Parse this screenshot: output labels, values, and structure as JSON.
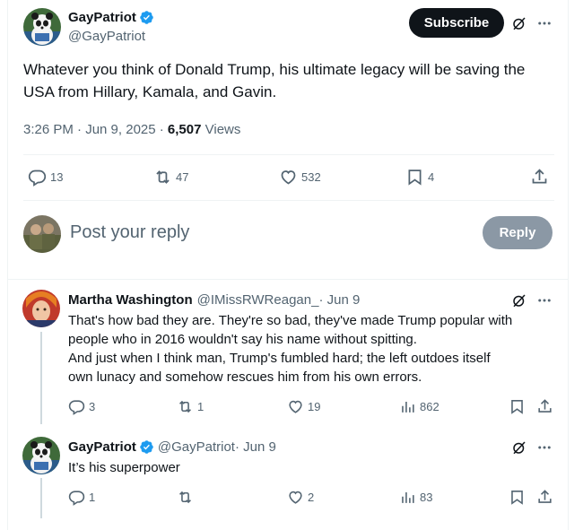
{
  "main_tweet": {
    "name": "GayPatriot",
    "handle": "@GayPatriot",
    "subscribe_label": "Subscribe",
    "text": "Whatever you think of Donald Trump, his ultimate legacy will be saving the USA from Hillary, Kamala, and Gavin.",
    "time": "3:26 PM · Jun 9, 2025 · ",
    "views_count": "6,507",
    "views_label": " Views",
    "replies": "13",
    "reposts": "47",
    "likes": "532",
    "bookmarks": "4"
  },
  "reply_composer": {
    "placeholder": "Post your reply",
    "button_label": "Reply"
  },
  "replies": [
    {
      "name": "Martha Washington",
      "handle": "@IMissRWReagan_",
      "time": " · Jun 9",
      "text_lines": [
        "That's how bad they are.  They're so bad, they've made Trump popular with",
        "people who in 2016 wouldn't say his name without spitting.",
        "And just when I think man, Trump's fumbled hard; the left outdoes itself",
        "own lunacy and somehow rescues him from his own errors."
      ],
      "replies": "3",
      "reposts": "1",
      "likes": "19",
      "views": "862"
    },
    {
      "name": "GayPatriot",
      "handle": "@GayPatriot",
      "time": " · Jun 9",
      "text_lines": [
        "It’s his superpower"
      ],
      "replies": "1",
      "reposts": "",
      "likes": "2",
      "views": "83"
    }
  ],
  "colors": {
    "verified": "#1d9bf0",
    "text_primary": "#0f1419",
    "text_secondary": "#536471",
    "reply_button_disabled": "#8b98a5"
  },
  "icons": {
    "reply": "speech-bubble-icon",
    "repost": "repost-icon",
    "like": "heart-icon",
    "bookmark": "bookmark-icon",
    "share": "share-icon",
    "views": "bar-chart-icon",
    "grok": "grok-icon",
    "more": "more-icon"
  }
}
